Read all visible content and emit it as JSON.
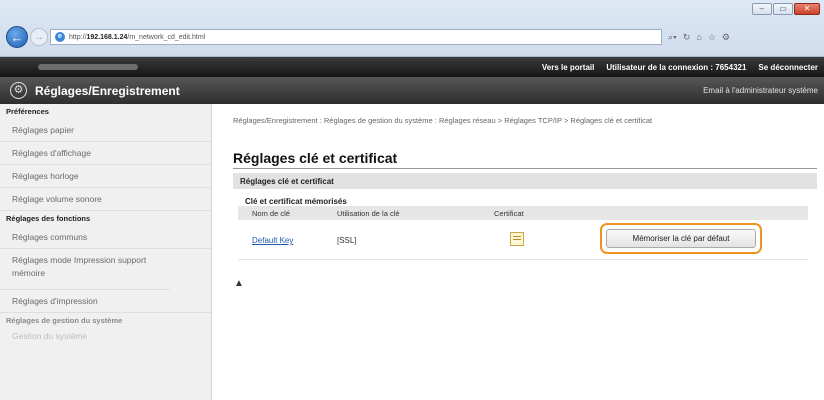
{
  "browser": {
    "url_prefix": "http://",
    "url_host": "192.168.1.24",
    "url_path": "/m_network_cd_edit.html",
    "window_buttons": [
      "–",
      "▭",
      "✕"
    ],
    "tool_icons": [
      "search-icon",
      "refresh-icon",
      "home-icon",
      "star-icon",
      "gear-icon"
    ]
  },
  "header": {
    "portal": "Vers le portail",
    "user_label": "Utilisateur de la connexion :",
    "user_id": "7654321",
    "logout": "Se déconnecter",
    "app_title": "Réglages/Enregistrement",
    "mail_admin": "Email à l'administrateur système"
  },
  "sidebar": {
    "sections": [
      {
        "heading": "Préférences",
        "items": [
          "Réglages papier",
          "Réglages d'affichage",
          "Réglages horloge",
          "Réglage volume sonore"
        ]
      },
      {
        "heading": "Réglages des fonctions",
        "items": [
          "Réglages communs",
          "Réglages mode Impression support mémoire",
          "Réglages d'impression"
        ]
      },
      {
        "heading": "Réglages de gestion du système",
        "items": [
          "Gestion du système"
        ]
      }
    ]
  },
  "main": {
    "breadcrumb": "Réglages/Enregistrement : Réglages de gestion du système : Réglages réseau > Réglages TCP/IP > Réglages clé et certificat",
    "title": "Réglages clé et certificat",
    "section_title": "Réglages clé et certificat",
    "table_title": "Clé et certificat mémorisés",
    "columns": [
      "Nom de clé",
      "Utilisation de la clé",
      "Certificat"
    ],
    "rows": [
      {
        "key_name": "Default Key",
        "usage": "[SSL]",
        "cert_icon": "certificate-icon",
        "action": "Mémoriser la clé par défaut"
      }
    ],
    "to_top": "▲"
  },
  "colors": {
    "highlight": "#f0941f",
    "link": "#1e5aa8",
    "header_dark": "#2e2e2e"
  }
}
